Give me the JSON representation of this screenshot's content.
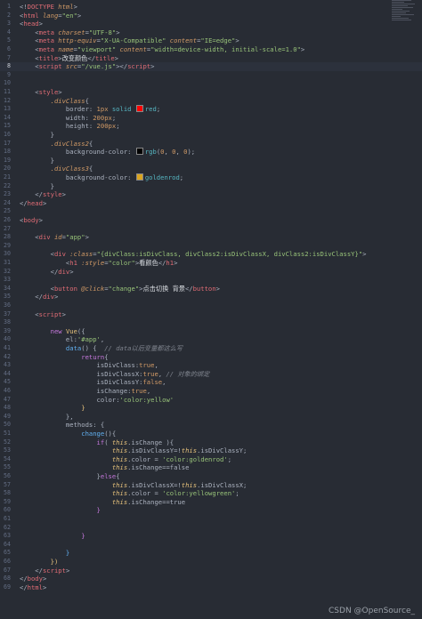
{
  "editor": {
    "active_line": 8,
    "lines": [
      {
        "n": "1",
        "tokens": [
          [
            "t-pun",
            "<!"
          ],
          [
            "t-tag",
            "DOCTYPE"
          ],
          [
            "t-attr",
            " html"
          ],
          [
            "t-pun",
            ">"
          ]
        ]
      },
      {
        "n": "2",
        "tokens": [
          [
            "t-pun",
            "<"
          ],
          [
            "t-tag",
            "html"
          ],
          [
            "t-attr",
            " lang"
          ],
          [
            "t-pun",
            "="
          ],
          [
            "t-str",
            "\"en\""
          ],
          [
            "t-pun",
            ">"
          ]
        ]
      },
      {
        "n": "3",
        "tokens": [
          [
            "t-pun",
            "<"
          ],
          [
            "t-tag",
            "head"
          ],
          [
            "t-pun",
            ">"
          ]
        ]
      },
      {
        "n": "4",
        "tokens": [
          [
            "t-pun",
            "    <"
          ],
          [
            "t-tag",
            "meta"
          ],
          [
            "t-attr",
            " charset"
          ],
          [
            "t-pun",
            "="
          ],
          [
            "t-str",
            "\"UTF-8\""
          ],
          [
            "t-pun",
            ">"
          ]
        ]
      },
      {
        "n": "5",
        "tokens": [
          [
            "t-pun",
            "    <"
          ],
          [
            "t-tag",
            "meta"
          ],
          [
            "t-attr",
            " http-equiv"
          ],
          [
            "t-pun",
            "="
          ],
          [
            "t-str",
            "\"X-UA-Compatible\""
          ],
          [
            "t-attr",
            " content"
          ],
          [
            "t-pun",
            "="
          ],
          [
            "t-str",
            "\"IE=edge\""
          ],
          [
            "t-pun",
            ">"
          ]
        ]
      },
      {
        "n": "6",
        "tokens": [
          [
            "t-pun",
            "    <"
          ],
          [
            "t-tag",
            "meta"
          ],
          [
            "t-attr",
            " name"
          ],
          [
            "t-pun",
            "="
          ],
          [
            "t-str",
            "\"viewport\""
          ],
          [
            "t-attr",
            " content"
          ],
          [
            "t-pun",
            "="
          ],
          [
            "t-str",
            "\"width=device-width, initial-scale=1.0\""
          ],
          [
            "t-pun",
            ">"
          ]
        ]
      },
      {
        "n": "7",
        "tokens": [
          [
            "t-pun",
            "    <"
          ],
          [
            "t-tag",
            "title"
          ],
          [
            "t-pun",
            ">"
          ],
          [
            "t-text",
            "改变颜色"
          ],
          [
            "t-pun",
            "</"
          ],
          [
            "t-tag",
            "title"
          ],
          [
            "t-pun",
            ">"
          ]
        ]
      },
      {
        "n": "8",
        "tokens": [
          [
            "t-pun",
            "    <"
          ],
          [
            "t-tag",
            "script"
          ],
          [
            "t-attr",
            " src"
          ],
          [
            "t-pun",
            "="
          ],
          [
            "t-str",
            "\"/vue.js\""
          ],
          [
            "t-pun",
            "></"
          ],
          [
            "t-tag",
            "script"
          ],
          [
            "t-pun",
            ">"
          ]
        ]
      },
      {
        "n": "9",
        "tokens": []
      },
      {
        "n": "10",
        "tokens": []
      },
      {
        "n": "11",
        "tokens": [
          [
            "t-pun",
            "    <"
          ],
          [
            "t-tag",
            "style"
          ],
          [
            "t-pun",
            ">"
          ]
        ]
      },
      {
        "n": "12",
        "tokens": [
          [
            "t-sel",
            "        .divClass"
          ],
          [
            "t-pun",
            "{"
          ]
        ]
      },
      {
        "n": "13",
        "tokens": [
          [
            "t-prop",
            "            border"
          ],
          [
            "t-pun",
            ": "
          ],
          [
            "t-num",
            "1px"
          ],
          [
            "t-val",
            " solid "
          ],
          [
            "swatch",
            "#ff0000"
          ],
          [
            "t-val",
            "red"
          ],
          [
            "t-pun",
            ";"
          ]
        ]
      },
      {
        "n": "14",
        "tokens": [
          [
            "t-prop",
            "            width"
          ],
          [
            "t-pun",
            ": "
          ],
          [
            "t-num",
            "200px"
          ],
          [
            "t-pun",
            ";"
          ]
        ]
      },
      {
        "n": "15",
        "tokens": [
          [
            "t-prop",
            "            height"
          ],
          [
            "t-pun",
            ": "
          ],
          [
            "t-num",
            "200px"
          ],
          [
            "t-pun",
            ";"
          ]
        ]
      },
      {
        "n": "16",
        "tokens": [
          [
            "t-pun",
            "        }"
          ]
        ]
      },
      {
        "n": "17",
        "tokens": [
          [
            "t-sel",
            "        .divClass2"
          ],
          [
            "t-pun",
            "{"
          ]
        ]
      },
      {
        "n": "18",
        "tokens": [
          [
            "t-prop",
            "            background-color"
          ],
          [
            "t-pun",
            ": "
          ],
          [
            "swatch",
            "#000000"
          ],
          [
            "t-val",
            "rgb"
          ],
          [
            "t-pun",
            "("
          ],
          [
            "t-num",
            "0"
          ],
          [
            "t-pun",
            ", "
          ],
          [
            "t-num",
            "0"
          ],
          [
            "t-pun",
            ", "
          ],
          [
            "t-num",
            "0"
          ],
          [
            "t-pun",
            ");"
          ]
        ]
      },
      {
        "n": "19",
        "tokens": [
          [
            "t-pun",
            "        }"
          ]
        ]
      },
      {
        "n": "20",
        "tokens": [
          [
            "t-sel",
            "        .divClass3"
          ],
          [
            "t-pun",
            "{"
          ]
        ]
      },
      {
        "n": "21",
        "tokens": [
          [
            "t-prop",
            "            background-color"
          ],
          [
            "t-pun",
            ": "
          ],
          [
            "swatch",
            "#daa520"
          ],
          [
            "t-val",
            "goldenrod"
          ],
          [
            "t-pun",
            ";"
          ]
        ]
      },
      {
        "n": "22",
        "tokens": [
          [
            "t-pun",
            "        }"
          ]
        ]
      },
      {
        "n": "23",
        "tokens": [
          [
            "t-pun",
            "    </"
          ],
          [
            "t-tag",
            "style"
          ],
          [
            "t-pun",
            ">"
          ]
        ]
      },
      {
        "n": "24",
        "tokens": [
          [
            "t-pun",
            "</"
          ],
          [
            "t-tag",
            "head"
          ],
          [
            "t-pun",
            ">"
          ]
        ]
      },
      {
        "n": "25",
        "tokens": []
      },
      {
        "n": "26",
        "tokens": [
          [
            "t-pun",
            "<"
          ],
          [
            "t-tag",
            "body"
          ],
          [
            "t-pun",
            ">"
          ]
        ]
      },
      {
        "n": "27",
        "tokens": []
      },
      {
        "n": "28",
        "tokens": [
          [
            "t-pun",
            "    <"
          ],
          [
            "t-tag",
            "div"
          ],
          [
            "t-attr",
            " id"
          ],
          [
            "t-pun",
            "="
          ],
          [
            "t-str",
            "\"app\""
          ],
          [
            "t-pun",
            ">"
          ]
        ]
      },
      {
        "n": "29",
        "tokens": []
      },
      {
        "n": "30",
        "tokens": [
          [
            "t-pun",
            "        <"
          ],
          [
            "t-tag",
            "div"
          ],
          [
            "t-attr",
            " :class"
          ],
          [
            "t-pun",
            "="
          ],
          [
            "t-str",
            "\"{divClass:isDivClass, divClass2:isDivClassX, divClass2:isDivClassY}\""
          ],
          [
            "t-pun",
            ">"
          ]
        ]
      },
      {
        "n": "31",
        "tokens": [
          [
            "t-pun",
            "            <"
          ],
          [
            "t-tag",
            "h1"
          ],
          [
            "t-attr",
            " :style"
          ],
          [
            "t-pun",
            "="
          ],
          [
            "t-str",
            "\"color\""
          ],
          [
            "t-pun",
            ">"
          ],
          [
            "t-text",
            "看颜色"
          ],
          [
            "t-pun",
            "</"
          ],
          [
            "t-tag",
            "h1"
          ],
          [
            "t-pun",
            ">"
          ]
        ]
      },
      {
        "n": "32",
        "tokens": [
          [
            "t-pun",
            "        </"
          ],
          [
            "t-tag",
            "div"
          ],
          [
            "t-pun",
            ">"
          ]
        ]
      },
      {
        "n": "33",
        "tokens": []
      },
      {
        "n": "34",
        "tokens": [
          [
            "t-pun",
            "        <"
          ],
          [
            "t-tag",
            "button"
          ],
          [
            "t-attr",
            " @click"
          ],
          [
            "t-pun",
            "="
          ],
          [
            "t-str",
            "\"change\""
          ],
          [
            "t-pun",
            ">"
          ],
          [
            "t-text",
            "点击切换 背景"
          ],
          [
            "t-pun",
            "</"
          ],
          [
            "t-tag",
            "button"
          ],
          [
            "t-pun",
            ">"
          ]
        ]
      },
      {
        "n": "35",
        "tokens": [
          [
            "t-pun",
            "    </"
          ],
          [
            "t-tag",
            "div"
          ],
          [
            "t-pun",
            ">"
          ]
        ]
      },
      {
        "n": "36",
        "tokens": []
      },
      {
        "n": "37",
        "tokens": [
          [
            "t-pun",
            "    <"
          ],
          [
            "t-tag",
            "script"
          ],
          [
            "t-pun",
            ">"
          ]
        ]
      },
      {
        "n": "38",
        "tokens": []
      },
      {
        "n": "39",
        "tokens": [
          [
            "t-kw",
            "        new "
          ],
          [
            "t-vue",
            "Vue"
          ],
          [
            "t-pun",
            "({"
          ]
        ]
      },
      {
        "n": "40",
        "tokens": [
          [
            "t-prop",
            "            el"
          ],
          [
            "t-pun",
            ":"
          ],
          [
            "t-str",
            "'#app'"
          ],
          [
            "t-pun",
            ","
          ]
        ]
      },
      {
        "n": "41",
        "tokens": [
          [
            "t-fn",
            "            data"
          ],
          [
            "t-pun",
            "() {  "
          ],
          [
            "t-com",
            "// data以后变量都这么写"
          ]
        ]
      },
      {
        "n": "42",
        "tokens": [
          [
            "t-kw",
            "                return"
          ],
          [
            "t-pun",
            "{"
          ]
        ]
      },
      {
        "n": "43",
        "tokens": [
          [
            "t-prop",
            "                    isDivClass"
          ],
          [
            "t-pun",
            ":"
          ],
          [
            "t-num",
            "true"
          ],
          [
            "t-pun",
            ","
          ]
        ]
      },
      {
        "n": "44",
        "tokens": [
          [
            "t-prop",
            "                    isDivClassX"
          ],
          [
            "t-pun",
            ":"
          ],
          [
            "t-num",
            "true"
          ],
          [
            "t-pun",
            ", "
          ],
          [
            "t-com",
            "// 对象的绑定"
          ]
        ]
      },
      {
        "n": "45",
        "tokens": [
          [
            "t-prop",
            "                    isDivClassY"
          ],
          [
            "t-pun",
            ":"
          ],
          [
            "t-num",
            "false"
          ],
          [
            "t-pun",
            ","
          ]
        ]
      },
      {
        "n": "46",
        "tokens": [
          [
            "t-prop",
            "                    isChange"
          ],
          [
            "t-pun",
            ":"
          ],
          [
            "t-num",
            "true"
          ],
          [
            "t-pun",
            ","
          ]
        ]
      },
      {
        "n": "47",
        "tokens": [
          [
            "t-prop",
            "                    color"
          ],
          [
            "t-pun",
            ":"
          ],
          [
            "t-str",
            "'color:yellow'"
          ]
        ]
      },
      {
        "n": "48",
        "tokens": [
          [
            "t-yel",
            "                }"
          ]
        ]
      },
      {
        "n": "49",
        "tokens": [
          [
            "t-pun",
            "            },"
          ]
        ]
      },
      {
        "n": "50",
        "tokens": [
          [
            "t-prop",
            "            methods"
          ],
          [
            "t-pun",
            ": {"
          ]
        ]
      },
      {
        "n": "51",
        "tokens": [
          [
            "t-fn",
            "                change"
          ],
          [
            "t-pun",
            "(){"
          ]
        ]
      },
      {
        "n": "52",
        "tokens": [
          [
            "t-kw",
            "                    if"
          ],
          [
            "t-pun",
            "( "
          ],
          [
            "t-this",
            "this"
          ],
          [
            "t-pun",
            ".isChange ){"
          ]
        ]
      },
      {
        "n": "53",
        "tokens": [
          [
            "t-this",
            "                        this"
          ],
          [
            "t-pun",
            ".isDivClassY=!"
          ],
          [
            "t-this",
            "this"
          ],
          [
            "t-pun",
            ".isDivClassY;"
          ]
        ]
      },
      {
        "n": "54",
        "tokens": [
          [
            "t-this",
            "                        this"
          ],
          [
            "t-pun",
            ".color = "
          ],
          [
            "t-str",
            "'color:goldenrod'"
          ],
          [
            "t-pun",
            ";"
          ]
        ]
      },
      {
        "n": "55",
        "tokens": [
          [
            "t-this",
            "                        this"
          ],
          [
            "t-pun",
            ".isChange==false"
          ]
        ]
      },
      {
        "n": "56",
        "tokens": [
          [
            "t-pun",
            "                    }"
          ],
          [
            "t-kw",
            "else"
          ],
          [
            "t-pun",
            "{"
          ]
        ]
      },
      {
        "n": "57",
        "tokens": [
          [
            "t-this",
            "                        this"
          ],
          [
            "t-pun",
            ".isDivClassX=!"
          ],
          [
            "t-this",
            "this"
          ],
          [
            "t-pun",
            ".isDivClassX;"
          ]
        ]
      },
      {
        "n": "58",
        "tokens": [
          [
            "t-this",
            "                        this"
          ],
          [
            "t-pun",
            ".color = "
          ],
          [
            "t-str",
            "'color:yellowgreen'"
          ],
          [
            "t-pun",
            ";"
          ]
        ]
      },
      {
        "n": "59",
        "tokens": [
          [
            "t-this",
            "                        this"
          ],
          [
            "t-pun",
            ".isChange==true"
          ]
        ]
      },
      {
        "n": "60",
        "tokens": [
          [
            "t-kw",
            "                    }"
          ]
        ]
      },
      {
        "n": "61",
        "tokens": []
      },
      {
        "n": "62",
        "tokens": []
      },
      {
        "n": "63",
        "tokens": [
          [
            "t-kw",
            "                }"
          ]
        ]
      },
      {
        "n": "64",
        "tokens": []
      },
      {
        "n": "65",
        "tokens": [
          [
            "t-fn",
            "            }"
          ]
        ]
      },
      {
        "n": "66",
        "tokens": [
          [
            "t-yel",
            "        })"
          ]
        ]
      },
      {
        "n": "67",
        "tokens": [
          [
            "t-pun",
            "    </"
          ],
          [
            "t-tag",
            "script"
          ],
          [
            "t-pun",
            ">"
          ]
        ]
      },
      {
        "n": "68",
        "tokens": [
          [
            "t-pun",
            "</"
          ],
          [
            "t-tag",
            "body"
          ],
          [
            "t-pun",
            ">"
          ]
        ]
      },
      {
        "n": "69",
        "tokens": [
          [
            "t-pun",
            "</"
          ],
          [
            "t-tag",
            "html"
          ],
          [
            "t-pun",
            ">"
          ]
        ]
      }
    ]
  },
  "watermark": "CSDN @OpenSource_"
}
